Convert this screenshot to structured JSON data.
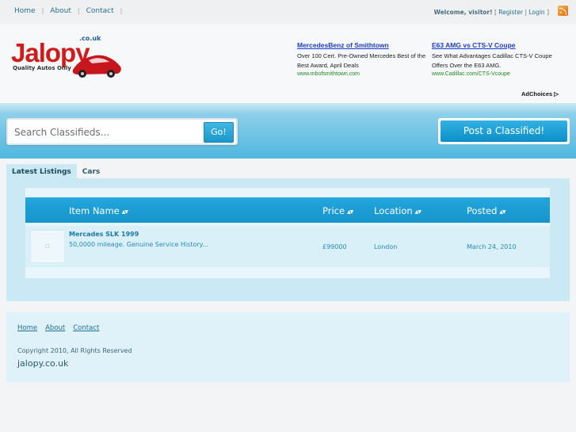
{
  "topnav": {
    "items": [
      {
        "label": "Home"
      },
      {
        "label": "About"
      },
      {
        "label": "Contact"
      }
    ],
    "separator": "|",
    "welcome_text": "Welcome, visitor!",
    "open_bracket": " [ ",
    "register_label": "Register",
    "mid_sep": " | ",
    "login_label": "Login",
    "close_bracket": " ]"
  },
  "logo": {
    "name": "Jalopy",
    "couk": ".co.uk",
    "tagline": "Quality Autos Only"
  },
  "ads": [
    {
      "title": "MercedesBenz of Smithtown",
      "body": "Over 100 Cert. Pre-Owned Mercedes Best of the Best Award, April Deals",
      "url": "www.mbofsmithtown.com"
    },
    {
      "title": "E63 AMG vs CTS-V Coupe",
      "body": "See What Advantages Cadillac CTS-V Coupe Offers Over the E63 AMG.",
      "url": "www.Cadillac.com/CTS-Vcoupe"
    }
  ],
  "adchoices": "AdChoices",
  "search": {
    "placeholder": "Search Classifieds...",
    "button": "Go!"
  },
  "post_button": "Post a Classified!",
  "tabs": [
    {
      "label": "Latest Listings",
      "active": true
    },
    {
      "label": "Cars",
      "active": false
    }
  ],
  "table": {
    "columns": [
      "Item Name",
      "Price",
      "Location",
      "Posted"
    ],
    "sort_glyph": "▲▼",
    "rows": [
      {
        "name": "Mercades SLK 1999",
        "description": "50,0000 mileage. Genuine Service History...",
        "price": "£99000",
        "location": "London",
        "posted": "March 24, 2010"
      }
    ]
  },
  "footer": {
    "links": [
      "Home",
      "About",
      "Contact"
    ],
    "copyright": "Copyright 2010, All Rights Reserved",
    "domain": "jalopy.co.uk"
  },
  "colors": {
    "accent": "#1594cb",
    "logo_red": "#d21a1a",
    "panel": "#cbe9f5"
  }
}
